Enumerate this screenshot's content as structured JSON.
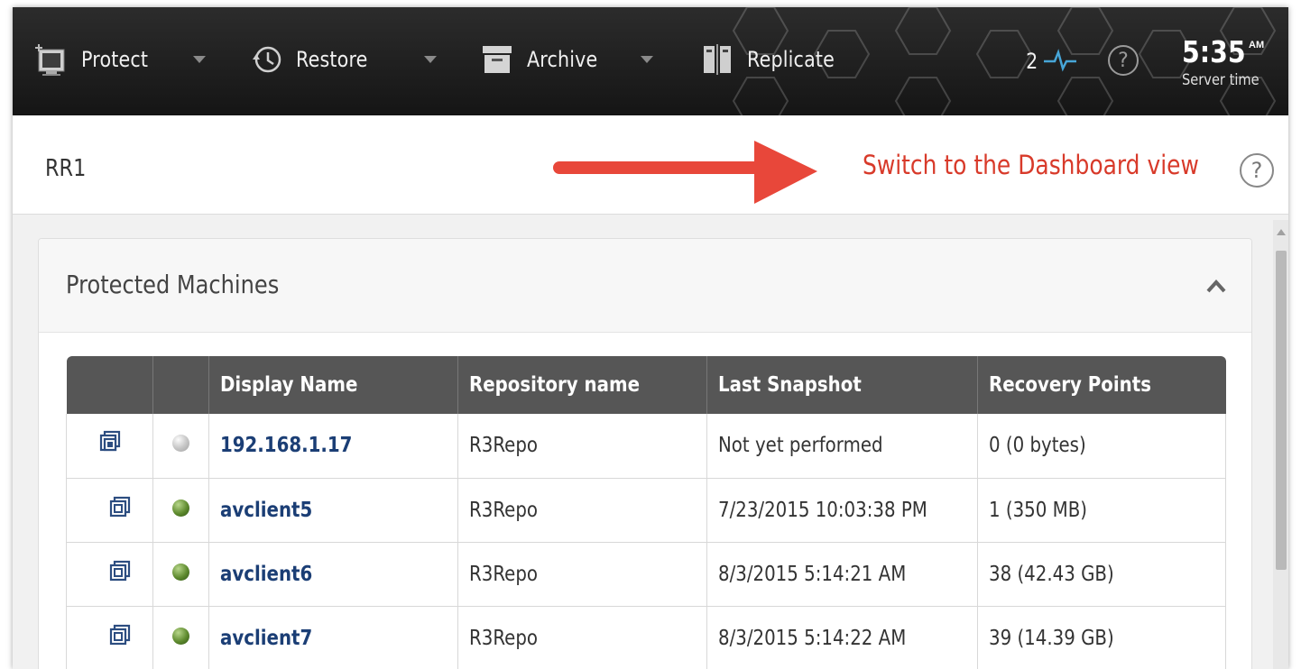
{
  "nav": {
    "items": [
      {
        "label": "Protect",
        "icon": "protect-icon",
        "has_caret": true
      },
      {
        "label": "Restore",
        "icon": "restore-clock-icon",
        "has_caret": true
      },
      {
        "label": "Archive",
        "icon": "archive-box-icon",
        "has_caret": true
      },
      {
        "label": "Replicate",
        "icon": "replicate-icon",
        "has_caret": false
      }
    ],
    "alert_count": "2",
    "help_symbol": "?",
    "time": "5:35",
    "ampm": "AM",
    "time_caption": "Server time"
  },
  "header": {
    "title": "RR1",
    "switch_link": "Switch to the Dashboard view",
    "help_symbol": "?",
    "arrow_color": "#e8473a",
    "link_color": "#d83a2a"
  },
  "panel": {
    "title": "Protected Machines",
    "columns": [
      "",
      "",
      "Display Name",
      "Repository name",
      "Last Snapshot",
      "Recovery Points"
    ],
    "rows": [
      {
        "status": "grey",
        "name": "192.168.1.17",
        "repository": "R3Repo",
        "last_snapshot": "Not yet performed",
        "recovery_points": "0 (0 bytes)"
      },
      {
        "status": "green",
        "name": "avclient5",
        "repository": "R3Repo",
        "last_snapshot": "7/23/2015 10:03:38 PM",
        "recovery_points": "1 (350 MB)"
      },
      {
        "status": "green",
        "name": "avclient6",
        "repository": "R3Repo",
        "last_snapshot": "8/3/2015 5:14:21 AM",
        "recovery_points": "38 (42.43 GB)"
      },
      {
        "status": "green",
        "name": "avclient7",
        "repository": "R3Repo",
        "last_snapshot": "8/3/2015 5:14:22 AM",
        "recovery_points": "39 (14.39 GB)"
      }
    ]
  }
}
